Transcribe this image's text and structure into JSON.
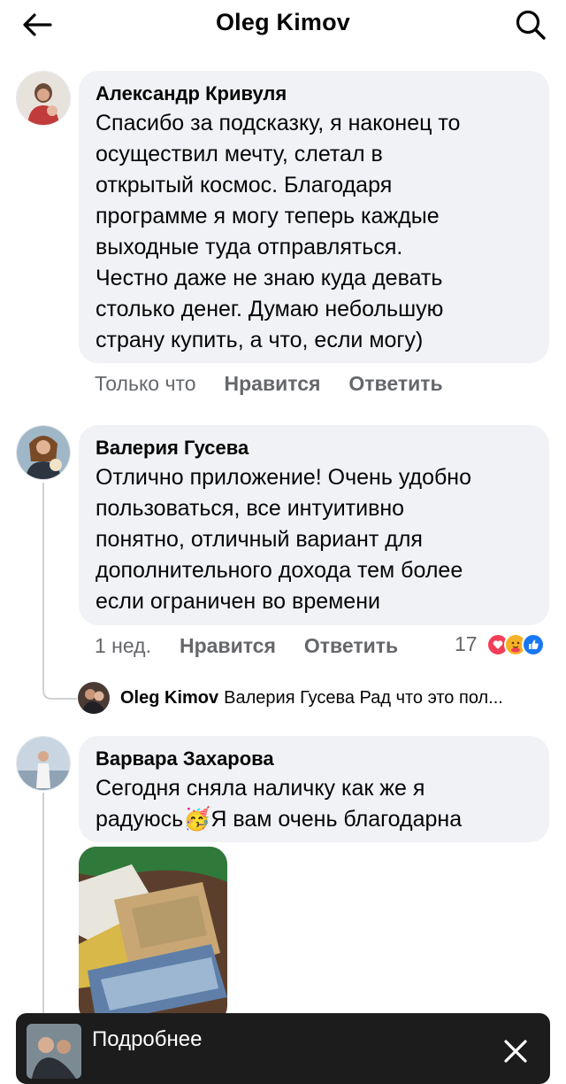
{
  "header": {
    "title": "Oleg Kimov",
    "back_icon": "arrow-left-icon",
    "search_icon": "search-icon"
  },
  "comments": [
    {
      "author": "Александр Кривуля",
      "lines": [
        "Спасибо за подсказку, я наконец то",
        "осуществил мечту, слетал в",
        "открытый космос. Благодаря",
        "программе я могу теперь каждые",
        "выходные туда отправляться.",
        "Честно даже не знаю куда девать",
        "столько денег. Думаю небольшую",
        "страну купить, а что, если могу)"
      ],
      "time": "Только что",
      "like": "Нравится",
      "reply": "Ответить"
    },
    {
      "author": "Валерия Гусева",
      "lines": [
        "Отлично приложение! Очень удобно",
        "пользоваться, все интуитивно",
        "понятно, отличный вариант для",
        "дополнительного дохода тем более",
        "если ограничен во времени"
      ],
      "time": "1 нед.",
      "like": "Нравится",
      "reply": "Ответить",
      "reaction_count": "17",
      "reactions": [
        "heart-icon",
        "hug-icon",
        "like-icon"
      ]
    },
    {
      "author": "Варвара Захарова",
      "line1": "Сегодня сняла наличку как же я",
      "line2_start": "радуюсь",
      "emoji": "🥳",
      "line2_end": "Я вам очень благодарна"
    }
  ],
  "reply_preview": {
    "name": "Oleg Kimov",
    "text": "Валерия Гусева Рад что это пол..."
  },
  "toast": {
    "label": "Подробнее",
    "close_icon": "close-icon"
  },
  "colors": {
    "bubble": "#f0f2f5",
    "secondary_text": "#65676b",
    "toast_bg": "#1c1c1c"
  }
}
